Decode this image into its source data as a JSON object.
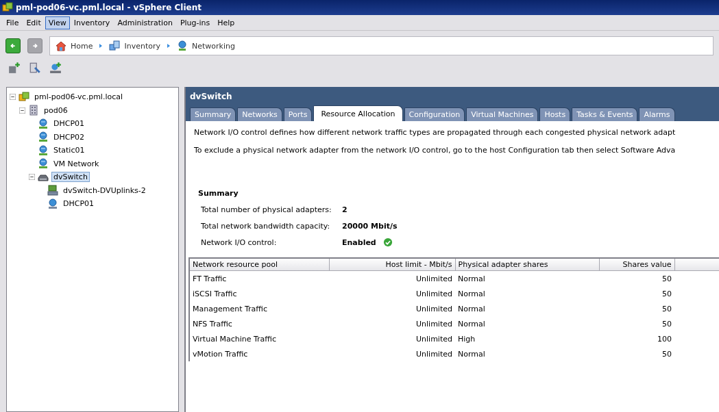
{
  "window": {
    "title": "pml-pod06-vc.pml.local - vSphere Client"
  },
  "menu": [
    {
      "label": "File",
      "selected": false
    },
    {
      "label": "Edit",
      "selected": false
    },
    {
      "label": "View",
      "selected": true
    },
    {
      "label": "Inventory",
      "selected": false
    },
    {
      "label": "Administration",
      "selected": false
    },
    {
      "label": "Plug-ins",
      "selected": false
    },
    {
      "label": "Help",
      "selected": false
    }
  ],
  "navigation": {
    "back": {
      "disabled": false
    },
    "forward": {
      "disabled": true
    },
    "breadcrumb": [
      {
        "label": "Home",
        "kind": "home"
      },
      {
        "label": "Inventory",
        "kind": "inventory"
      },
      {
        "label": "Networking",
        "kind": "networking"
      }
    ]
  },
  "tree": [
    {
      "label": "pml-pod06-vc.pml.local",
      "kind": "vcenter",
      "selected": false,
      "expanded": true,
      "children": [
        {
          "label": "pod06",
          "kind": "datacenter",
          "selected": false,
          "expanded": true,
          "children": [
            {
              "label": "DHCP01",
              "kind": "portgroup",
              "selected": false
            },
            {
              "label": "DHCP02",
              "kind": "portgroup",
              "selected": false
            },
            {
              "label": "Static01",
              "kind": "portgroup",
              "selected": false
            },
            {
              "label": "VM Network",
              "kind": "portgroup",
              "selected": false
            },
            {
              "label": "dvSwitch",
              "kind": "switch",
              "selected": true,
              "expanded": true,
              "children": [
                {
                  "label": "dvSwitch-DVUplinks-2",
                  "kind": "uplink",
                  "selected": false
                },
                {
                  "label": "DHCP01",
                  "kind": "dvportgroup",
                  "selected": false
                }
              ]
            }
          ]
        }
      ]
    }
  ],
  "detail": {
    "title": "dvSwitch",
    "tabs": [
      {
        "label": "Summary",
        "selected": false
      },
      {
        "label": "Networks",
        "selected": false
      },
      {
        "label": "Ports",
        "selected": false
      },
      {
        "label": "Resource Allocation",
        "selected": true
      },
      {
        "label": "Configuration",
        "selected": false
      },
      {
        "label": "Virtual Machines",
        "selected": false
      },
      {
        "label": "Hosts",
        "selected": false
      },
      {
        "label": "Tasks & Events",
        "selected": false
      },
      {
        "label": "Alarms",
        "selected": false
      }
    ],
    "description": [
      "Network I/O control defines how different network traffic types are propagated through each congested physical network adapt",
      "To exclude a physical network adapter from the network I/O control, go to the host Configuration tab then select Software Adva"
    ],
    "summary": {
      "heading": "Summary",
      "rows": [
        {
          "label": "Total number of physical adapters:",
          "value": "2"
        },
        {
          "label": "Total network bandwidth capacity:",
          "value": "20000 Mbit/s"
        },
        {
          "label": "Network I/O control:",
          "value": "Enabled",
          "ok": true
        }
      ]
    },
    "table": {
      "columns": [
        "Network resource pool",
        "Host limit - Mbit/s",
        "Physical adapter shares",
        "Shares value"
      ],
      "rows": [
        [
          "FT Traffic",
          "Unlimited",
          "Normal",
          "50"
        ],
        [
          "iSCSI Traffic",
          "Unlimited",
          "Normal",
          "50"
        ],
        [
          "Management Traffic",
          "Unlimited",
          "Normal",
          "50"
        ],
        [
          "NFS Traffic",
          "Unlimited",
          "Normal",
          "50"
        ],
        [
          "Virtual Machine Traffic",
          "Unlimited",
          "High",
          "100"
        ],
        [
          "vMotion Traffic",
          "Unlimited",
          "Normal",
          "50"
        ]
      ]
    }
  }
}
